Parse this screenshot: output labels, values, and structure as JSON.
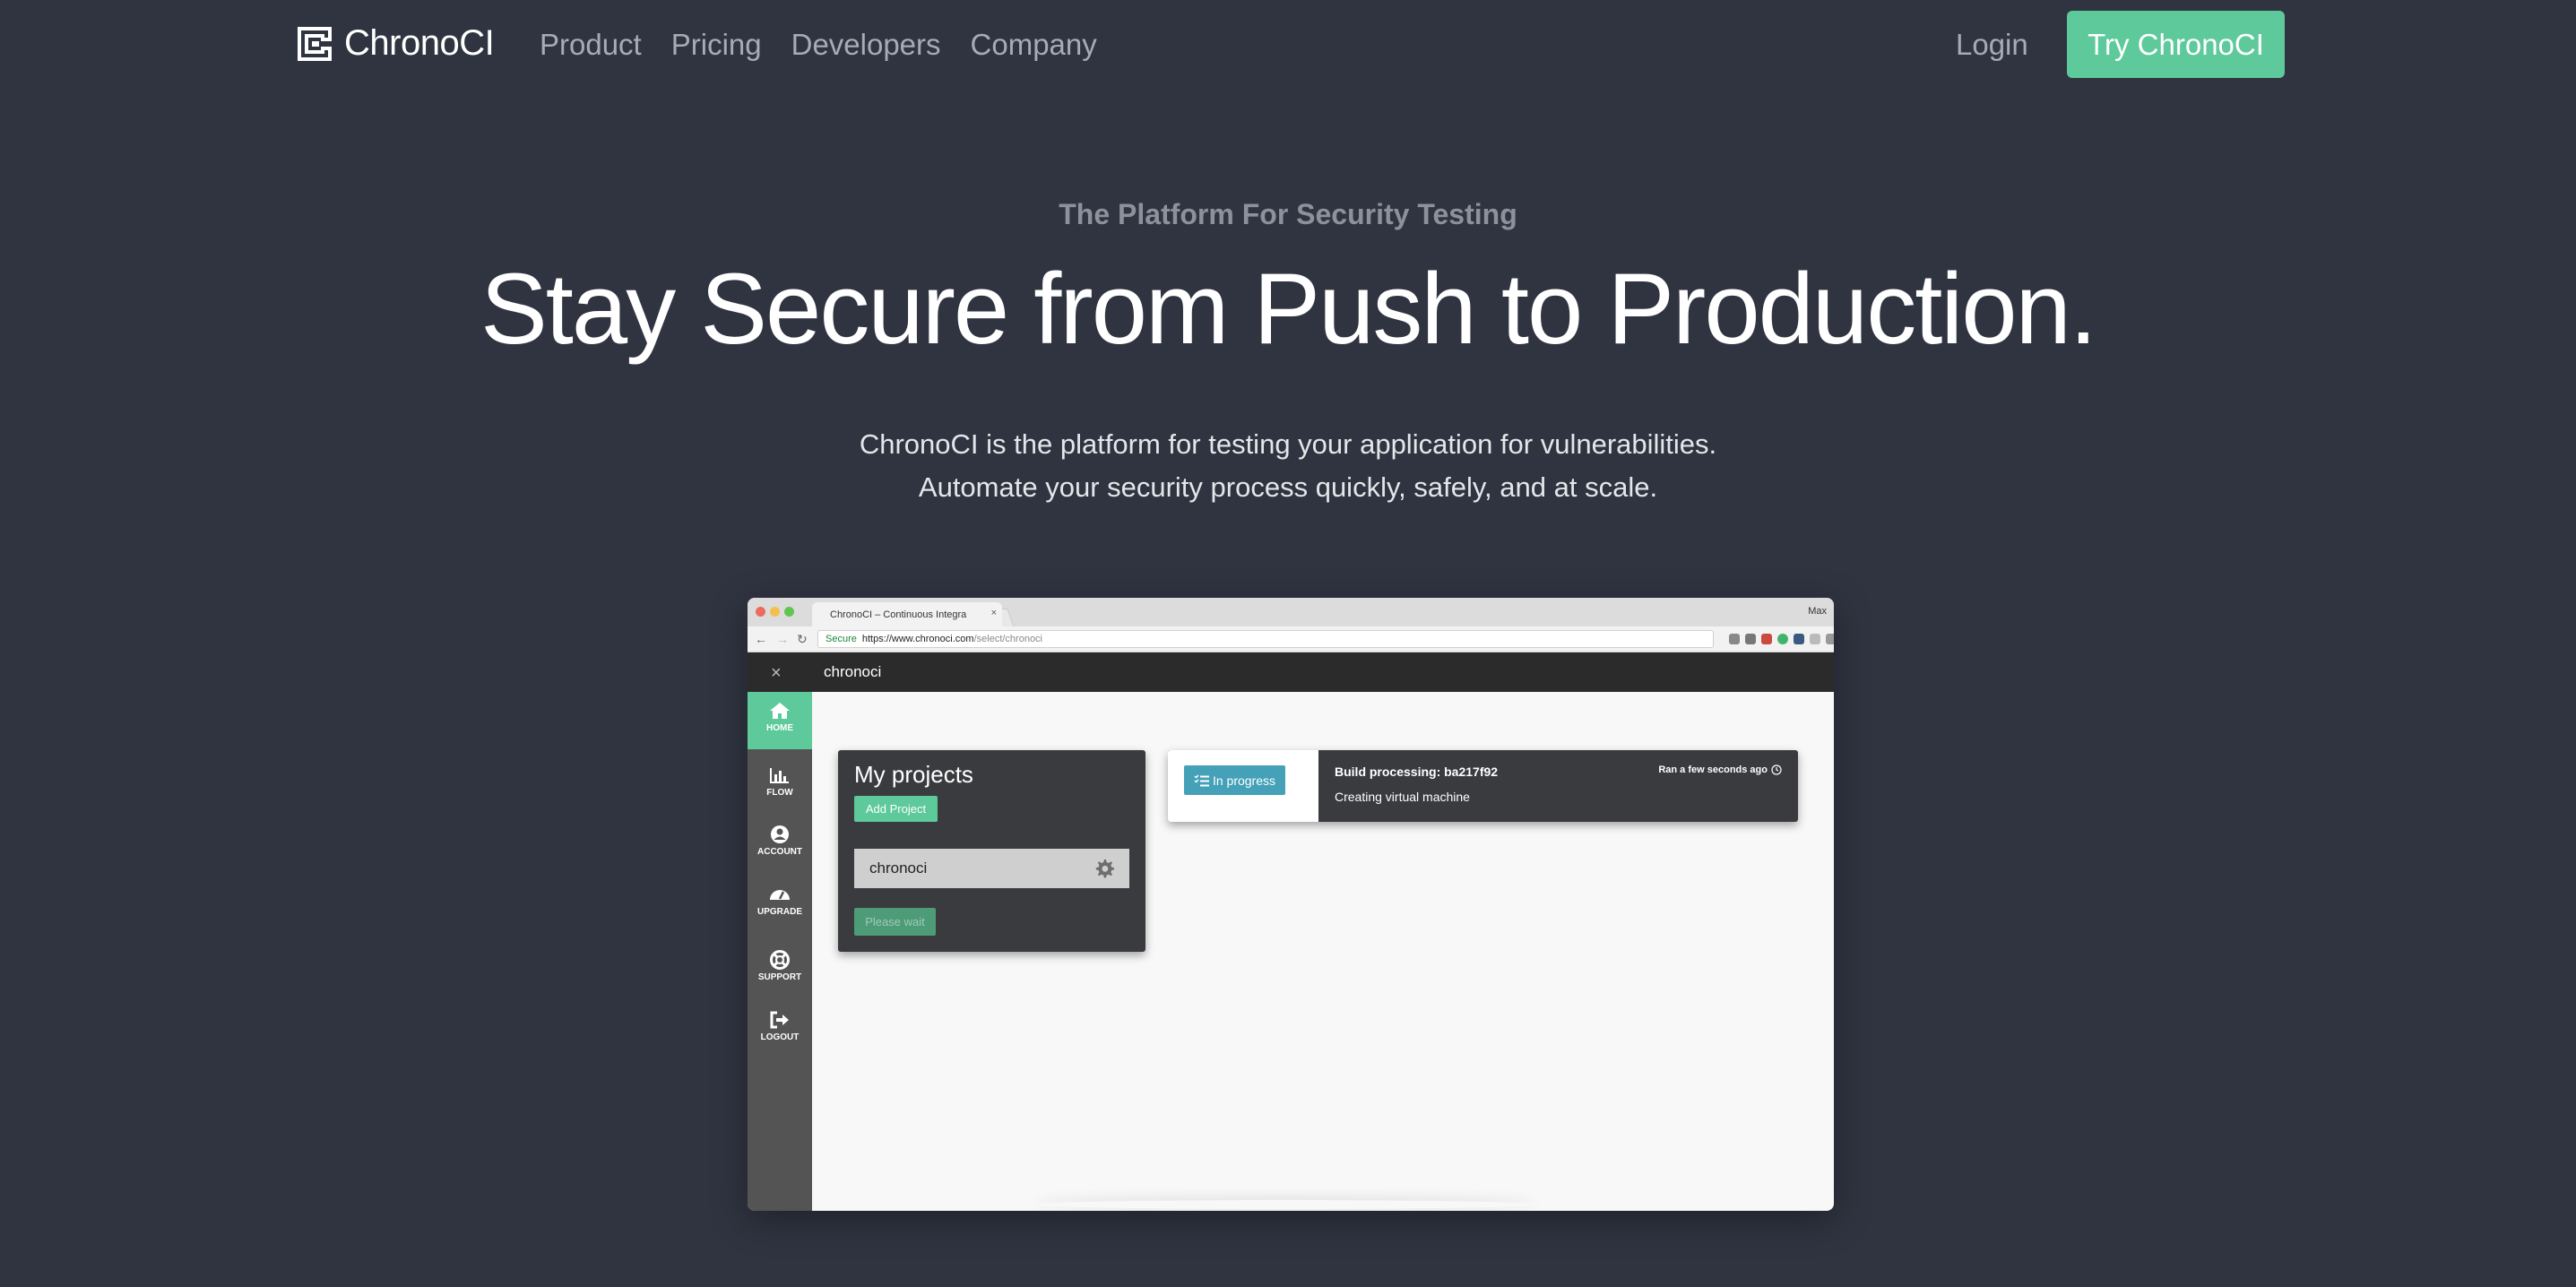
{
  "nav": {
    "brand": "ChronoCI",
    "links": [
      "Product",
      "Pricing",
      "Developers",
      "Company"
    ],
    "login": "Login",
    "cta": "Try ChronoCI"
  },
  "hero": {
    "eyebrow": "The Platform For Security Testing",
    "headline": "Stay Secure from Push to Production.",
    "subtitle_line1": "ChronoCI is the platform for testing your application for vulnerabilities.",
    "subtitle_line2": "Automate your security process quickly, safely, and at scale."
  },
  "mockup": {
    "browser": {
      "tab_title": "ChronoCI – Continuous Integra",
      "profile": "Max",
      "url_secure": "Secure",
      "url_host": "https://www.chronoci.com",
      "url_path": "/select/chronoci"
    },
    "app": {
      "title": "chronoci",
      "close": "×",
      "sidebar": [
        {
          "label": "HOME",
          "icon": "home-icon",
          "active": true
        },
        {
          "label": "FLOW",
          "icon": "bar-chart-icon"
        },
        {
          "label": "ACCOUNT",
          "icon": "user-icon"
        },
        {
          "label": "UPGRADE",
          "icon": "gauge-icon"
        },
        {
          "label": "SUPPORT",
          "icon": "lifebuoy-icon"
        },
        {
          "label": "LOGOUT",
          "icon": "logout-icon"
        }
      ],
      "projects": {
        "title": "My projects",
        "add_button": "Add Project",
        "items": [
          "chronoci"
        ],
        "wait_button": "Please wait"
      },
      "build": {
        "status_button": "In progress",
        "title": "Build processing: ba217f92",
        "subtitle": "Creating virtual machine",
        "time": "Ran a few seconds ago"
      }
    }
  },
  "colors": {
    "background": "#2f3440",
    "accent": "#5ec99a",
    "info": "#44a1b8"
  }
}
